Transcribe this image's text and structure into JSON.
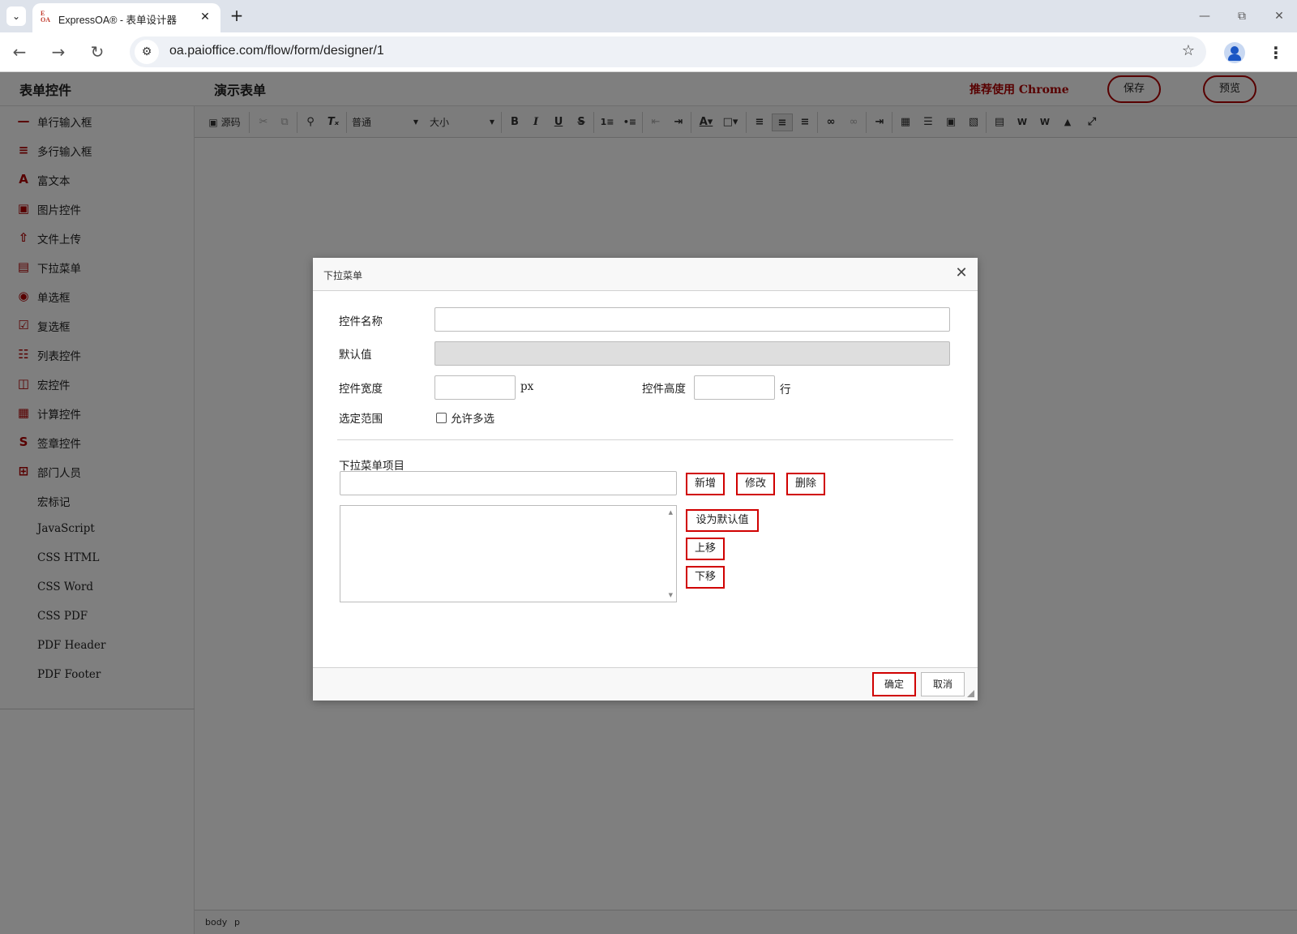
{
  "browser": {
    "tab_title": "ExpressOA® - 表单设计器",
    "favicon_text_top": "E",
    "favicon_text_bottom": "OA",
    "url": "oa.paioffice.com/flow/form/designer/1"
  },
  "header": {
    "sidebar_title": "表单控件",
    "form_title": "演示表单",
    "recommend_text": "推荐使用 Chrome",
    "save_label": "保存",
    "preview_label": "预览"
  },
  "sidebar": {
    "items": [
      {
        "label": "单行输入框",
        "icon": "single-line-icon"
      },
      {
        "label": "多行输入框",
        "icon": "multi-line-icon"
      },
      {
        "label": "富文本",
        "icon": "rich-text-icon"
      },
      {
        "label": "图片控件",
        "icon": "image-icon"
      },
      {
        "label": "文件上传",
        "icon": "file-upload-icon"
      },
      {
        "label": "下拉菜单",
        "icon": "dropdown-icon"
      },
      {
        "label": "单选框",
        "icon": "radio-icon"
      },
      {
        "label": "复选框",
        "icon": "checkbox-icon"
      },
      {
        "label": "列表控件",
        "icon": "list-icon"
      },
      {
        "label": "宏控件",
        "icon": "macro-icon"
      },
      {
        "label": "计算控件",
        "icon": "calculator-icon"
      },
      {
        "label": "签章控件",
        "icon": "signature-icon"
      },
      {
        "label": "部门人员",
        "icon": "department-icon"
      },
      {
        "label": "宏标记",
        "icon": ""
      },
      {
        "label": "JavaScript",
        "icon": ""
      },
      {
        "label": "CSS HTML",
        "icon": ""
      },
      {
        "label": "CSS Word",
        "icon": ""
      },
      {
        "label": "CSS PDF",
        "icon": ""
      },
      {
        "label": "PDF Header",
        "icon": ""
      },
      {
        "label": "PDF Footer",
        "icon": ""
      }
    ]
  },
  "editor": {
    "source_label": "源码",
    "format_value": "普通",
    "size_value": "大小",
    "status_path": [
      "body",
      "p"
    ]
  },
  "dialog": {
    "title": "下拉菜单",
    "control_name_label": "控件名称",
    "control_name_value": "",
    "default_value_label": "默认值",
    "default_value": "",
    "width_label": "控件宽度",
    "width_value": "",
    "width_unit": "px",
    "height_label": "控件高度",
    "height_value": "",
    "height_unit": "行",
    "range_label": "选定范围",
    "allow_multi_label": "允许多选",
    "allow_multi_checked": false,
    "items_label": "下拉菜单项目",
    "item_input_value": "",
    "add_label": "新增",
    "edit_label": "修改",
    "delete_label": "删除",
    "set_default_label": "设为默认值",
    "move_up_label": "上移",
    "move_down_label": "下移",
    "ok_label": "确定",
    "cancel_label": "取消"
  },
  "colors": {
    "accent": "#b00000",
    "button_border": "#d00000",
    "overlay": "#808080"
  }
}
